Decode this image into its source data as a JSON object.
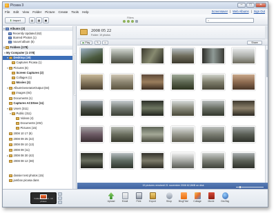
{
  "window": {
    "title": "Picasa 3"
  },
  "menu": [
    "File",
    "Edit",
    "View",
    "Folder",
    "Picture",
    "Create",
    "Tools",
    "Help"
  ],
  "top_links": {
    "screensaver": "Screensaver",
    "web_albums": "Web Albums",
    "sign_out": "Sign Out",
    "separator": "|"
  },
  "toolbar": {
    "import_label": "Import",
    "filters_label": "Filters",
    "search_placeholder": ""
  },
  "sidebar": {
    "albums_header": "Albums (3)",
    "albums": [
      "Recently Updated (62)",
      "Starred Photos (1)",
      "nouvel album (5)"
    ],
    "folders_header": "Folders (178)",
    "my_computer": "My Computer (1·378)",
    "items": [
      "Desktop (19)",
      "Captures Picasa (1)",
      "Pictures (6)",
      "Screen Captures (2)",
      "Collages (1)",
      "Movies (3)",
      "AlbumGeneratorOutput (84)",
      "images (84)",
      "Documents (1)",
      "Captures ACDSee (11)",
      "Users (311)",
      "Public (311)",
      "Videos (4)",
      "Documents (202)",
      "Pictures (15)",
      "2008 10 17 (8)",
      "2008 09 25 (22)",
      "2008 09 10 (13)",
      "2008 09 (11)",
      "2008 08 30 (42)",
      "2008 08 12 (38)",
      "dossier test photos (15)",
      "jambox picasa dans"
    ]
  },
  "folder": {
    "title": "2008 05 22",
    "subtitle": "Folder: 19 photos"
  },
  "action_bar": {
    "play": "Play",
    "middle": "",
    "share": "Share"
  },
  "status": {
    "text": "19 pictures     vendredi 21 novembre 2008     62,8MB on disk"
  },
  "tray": {
    "label": "Folder Selected - 19 photos"
  },
  "bottom_tools": [
    "Upload",
    "Email",
    "Print",
    "Export",
    "Shop",
    "BlogThis!",
    "Collage",
    "Movie",
    "GeoTag"
  ]
}
